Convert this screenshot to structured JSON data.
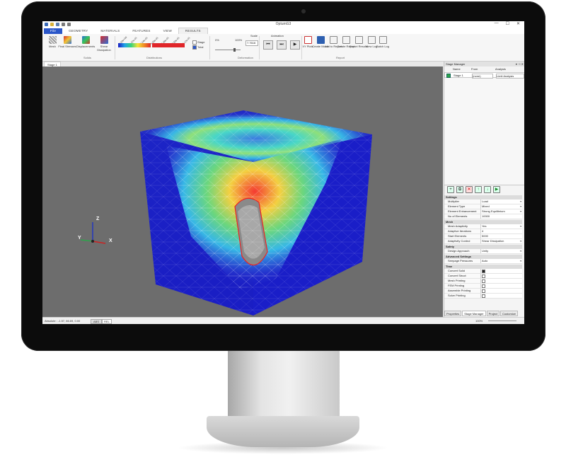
{
  "app": {
    "title": "OptumG3",
    "window_controls": [
      "—",
      "☐",
      "✕"
    ]
  },
  "tabs": [
    {
      "label": "File",
      "active": false
    },
    {
      "label": "GEOMETRY",
      "active": false
    },
    {
      "label": "MATERIALS",
      "active": false
    },
    {
      "label": "FEATURES",
      "active": false
    },
    {
      "label": "VIEW",
      "active": false
    },
    {
      "label": "RESULTS",
      "active": true
    }
  ],
  "ribbon": {
    "mesh": "Mesh",
    "final_stresses": "Final Stresses",
    "displacements": "Displacements",
    "shear_dissipation": "Shear Dissipation",
    "group_solids": "Solids",
    "group_distributions": "Distributions",
    "stage_label": "Stage",
    "total_label": "Total",
    "stage_checked": false,
    "total_checked": true,
    "deformation_min": "0%",
    "deformation_max": "100%",
    "scale_label": "Scale",
    "scale_value": "7.7616",
    "group_deformation": "Deformation",
    "animation_label": "Animation",
    "xy_plots": "XY Plots",
    "create_movie": "Create Movie",
    "add_to_report": "Add to Report",
    "create_report": "Create Report",
    "export_results": "Export Results",
    "view_log": "View Log",
    "batch_log": "Batch Log",
    "group_report": "Report",
    "group_plots": "Plots",
    "colormap_ticks": [
      "0.00e+00",
      "1.52e-01",
      "3.04e-01",
      "4.56e-01",
      "6.08e-01",
      "7.60e-01",
      "9.12e-01"
    ]
  },
  "viewport": {
    "tab_label": "Stage 1",
    "axes": {
      "z": "Z",
      "y": "Y",
      "x": "X"
    }
  },
  "statusbar": {
    "coords": "Absolute : -1.57, 66.69, 0.00",
    "abs": "ABS",
    "rel": "REL",
    "zoom": "100%"
  },
  "stage_manager": {
    "title": "Stage Manager",
    "columns": [
      "Name",
      "From",
      "Analysis"
    ],
    "stages": [
      {
        "name": "Stage 1",
        "from": "(none)",
        "analysis": "Limit Analysis",
        "checked": true
      }
    ]
  },
  "properties": {
    "sections": [
      {
        "title": "Settings",
        "rows": [
          {
            "key": "Multiplier",
            "value": "Load",
            "type": "dropdown"
          },
          {
            "key": "Element Type",
            "value": "Mixed",
            "type": "dropdown"
          },
          {
            "key": "Element Enhancement",
            "value": "Strong Equilibrium",
            "type": "dropdown"
          },
          {
            "key": "No of Elements",
            "value": "10000",
            "type": "text"
          }
        ]
      },
      {
        "title": "Mesh",
        "rows": [
          {
            "key": "Mesh Adaptivity",
            "value": "Yes",
            "type": "dropdown"
          },
          {
            "key": "Adaptive Iterations",
            "value": "4",
            "type": "text"
          },
          {
            "key": "Start Elements",
            "value": "5000",
            "type": "text"
          },
          {
            "key": "Adaptivity Control",
            "value": "Shear Dissipation",
            "type": "dropdown"
          }
        ]
      },
      {
        "title": "Safety",
        "rows": [
          {
            "key": "Design Approach",
            "value": "Unity",
            "type": "dropdown"
          }
        ]
      },
      {
        "title": "Advanced Settings",
        "rows": [
          {
            "key": "Seepage Pressures",
            "value": "Auto",
            "type": "dropdown"
          }
        ]
      },
      {
        "title": "Time",
        "rows": [
          {
            "key": "Convert Solid",
            "value": "",
            "type": "checkbox",
            "checked": true
          },
          {
            "key": "Convert Struct",
            "value": "",
            "type": "checkbox",
            "checked": false
          },
          {
            "key": "Mesh Printing",
            "value": "",
            "type": "checkbox",
            "checked": false
          },
          {
            "key": "FEM Printing",
            "value": "",
            "type": "checkbox",
            "checked": false
          },
          {
            "key": "Assemble Printing",
            "value": "",
            "type": "checkbox",
            "checked": false
          },
          {
            "key": "Solve Printing",
            "value": "",
            "type": "checkbox",
            "checked": false
          }
        ]
      }
    ]
  },
  "panel_tabs": [
    "Properties",
    "Stage Manager",
    "Project",
    "Customize"
  ],
  "colors": {
    "file_tab": "#2b57c9",
    "viewport_bg": "#6d6d6d",
    "block_blue": "#1a1dc4"
  }
}
